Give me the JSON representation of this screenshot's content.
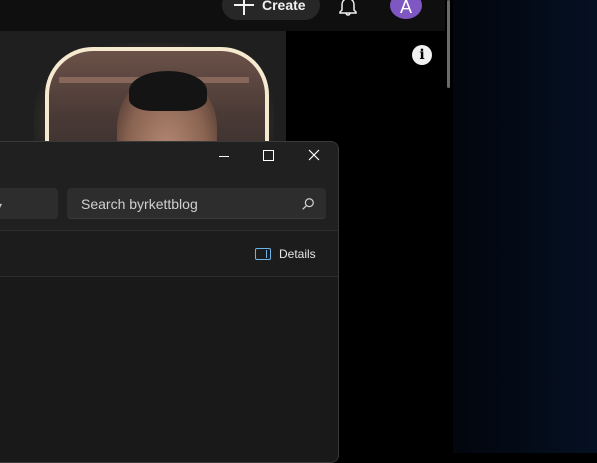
{
  "browser": {
    "header": {
      "create_label": "Create",
      "avatar_letter": "A"
    }
  },
  "explorer": {
    "search_placeholder": "Search byrkettblog",
    "details_label": "Details"
  },
  "colors": {
    "avatar_bg": "#7e57c2",
    "details_accent": "#6cb4e8"
  }
}
